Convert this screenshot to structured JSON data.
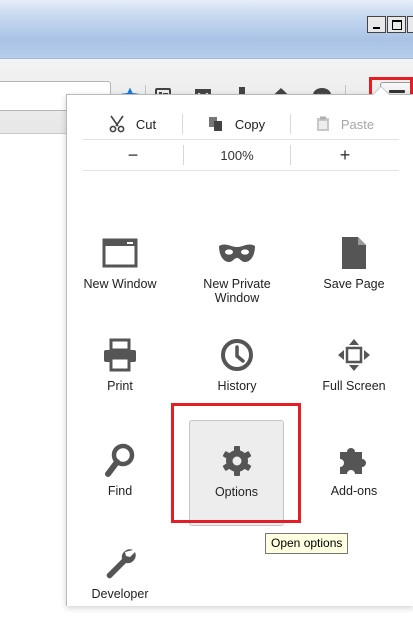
{
  "menu": {
    "edit": {
      "cut": "Cut",
      "copy": "Copy",
      "paste": "Paste"
    },
    "zoom": {
      "out": "−",
      "level": "100%",
      "in": "+"
    },
    "items": [
      {
        "label": "New Window",
        "icon": "new-window-icon"
      },
      {
        "label": "New Private Window",
        "icon": "private-mask-icon"
      },
      {
        "label": "Save Page",
        "icon": "save-page-icon"
      },
      {
        "label": "Print",
        "icon": "printer-icon"
      },
      {
        "label": "History",
        "icon": "clock-icon"
      },
      {
        "label": "Full Screen",
        "icon": "fullscreen-icon"
      },
      {
        "label": "Find",
        "icon": "magnifier-icon"
      },
      {
        "label": "Options",
        "icon": "gear-icon"
      },
      {
        "label": "Add-ons",
        "icon": "puzzle-icon"
      },
      {
        "label": "Developer",
        "icon": "wrench-icon"
      }
    ]
  },
  "tooltip": "Open options",
  "colors": {
    "highlight": "#e31e25",
    "bookmark_star": "#1d7bd6",
    "icon_gray": "#555555"
  }
}
